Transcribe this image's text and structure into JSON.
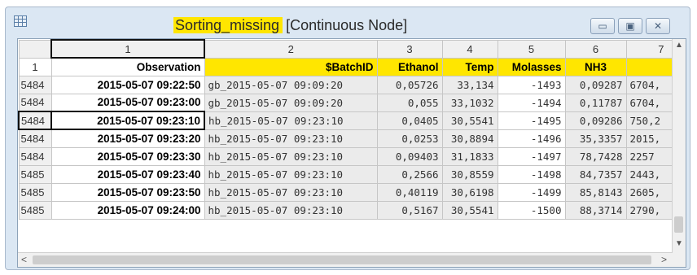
{
  "window": {
    "title_name": "Sorting_missing",
    "title_rest": "[Continuous Node]",
    "minimize_icon": "minimize-icon",
    "maximize_icon": "maximize-icon",
    "close_icon": "close-icon"
  },
  "colors": {
    "highlight": "#ffe600"
  },
  "grid": {
    "column_numbers": [
      "",
      "1",
      "2",
      "3",
      "4",
      "5",
      "6",
      "7"
    ],
    "header_row_number": "1",
    "column_names": [
      "Observation",
      "$BatchID",
      "Ethanol",
      "Temp",
      "Molasses",
      "NH3",
      ""
    ],
    "rows": [
      {
        "num": "5484",
        "obs": "2015-05-07 09:22:50",
        "batch": "gb_2015-05-07 09:09:20",
        "ethanol": "0,05726",
        "temp": "33,134",
        "molasses": "-1493",
        "nh3": "0,09287",
        "c7": "6704,"
      },
      {
        "num": "5484",
        "obs": "2015-05-07 09:23:00",
        "batch": "gb_2015-05-07 09:09:20",
        "ethanol": "0,055",
        "temp": "33,1032",
        "molasses": "-1494",
        "nh3": "0,11787",
        "c7": "6704,"
      },
      {
        "num": "5484",
        "obs": "2015-05-07 09:23:10",
        "batch": "hb_2015-05-07 09:23:10",
        "ethanol": "0,0405",
        "temp": "30,5541",
        "molasses": "-1495",
        "nh3": "0,09286",
        "c7": "750,2"
      },
      {
        "num": "5484",
        "obs": "2015-05-07 09:23:20",
        "batch": "hb_2015-05-07 09:23:10",
        "ethanol": "0,0253",
        "temp": "30,8894",
        "molasses": "-1496",
        "nh3": "35,3357",
        "c7": "2015,"
      },
      {
        "num": "5484",
        "obs": "2015-05-07 09:23:30",
        "batch": "hb_2015-05-07 09:23:10",
        "ethanol": "0,09403",
        "temp": "31,1833",
        "molasses": "-1497",
        "nh3": "78,7428",
        "c7": "2257"
      },
      {
        "num": "5485",
        "obs": "2015-05-07 09:23:40",
        "batch": "hb_2015-05-07 09:23:10",
        "ethanol": "0,2566",
        "temp": "30,8559",
        "molasses": "-1498",
        "nh3": "84,7357",
        "c7": "2443,"
      },
      {
        "num": "5485",
        "obs": "2015-05-07 09:23:50",
        "batch": "hb_2015-05-07 09:23:10",
        "ethanol": "0,40119",
        "temp": "30,6198",
        "molasses": "-1499",
        "nh3": "85,8143",
        "c7": "2605,"
      },
      {
        "num": "5485",
        "obs": "2015-05-07 09:24:00",
        "batch": "hb_2015-05-07 09:23:10",
        "ethanol": "0,5167",
        "temp": "30,5541",
        "molasses": "-1500",
        "nh3": "88,3714",
        "c7": "2790,"
      }
    ]
  },
  "scroll": {
    "up": "▲",
    "down": "▼",
    "left": "<",
    "right": ">"
  }
}
